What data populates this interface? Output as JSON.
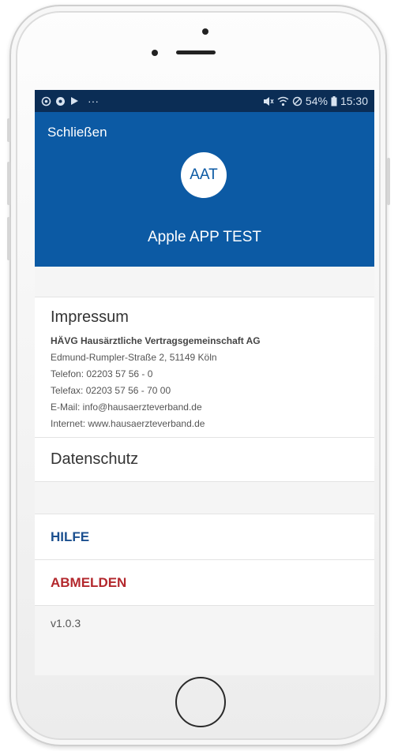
{
  "status_bar": {
    "left_icons": [
      "whatsapp-icon",
      "chrome-icon",
      "play-icon",
      "more-dots-icon"
    ],
    "more": "···",
    "battery": "54%",
    "time": "15:30"
  },
  "header": {
    "close_label": "Schließen",
    "avatar_text": "AAT",
    "app_name": "Apple APP TEST"
  },
  "impressum": {
    "title": "Impressum",
    "company": "HÄVG Hausärztliche Vertragsgemeinschaft AG",
    "address": "Edmund-Rumpler-Straße 2, 51149 Köln",
    "phone": "Telefon: 02203 57 56 - 0",
    "fax": "Telefax: 02203 57 56 - 70 00",
    "email": "E-Mail: info@hausaerzteverband.de",
    "internet": "Internet: www.hausaerzteverband.de"
  },
  "datenschutz": {
    "title": "Datenschutz"
  },
  "menu": {
    "help_label": "HILFE",
    "logout_label": "ABMELDEN"
  },
  "version": "v1.0.3",
  "colors": {
    "status_bar": "#0b2d55",
    "header": "#0c5aa4",
    "help": "#1b4f8f",
    "logout": "#b3282d"
  }
}
